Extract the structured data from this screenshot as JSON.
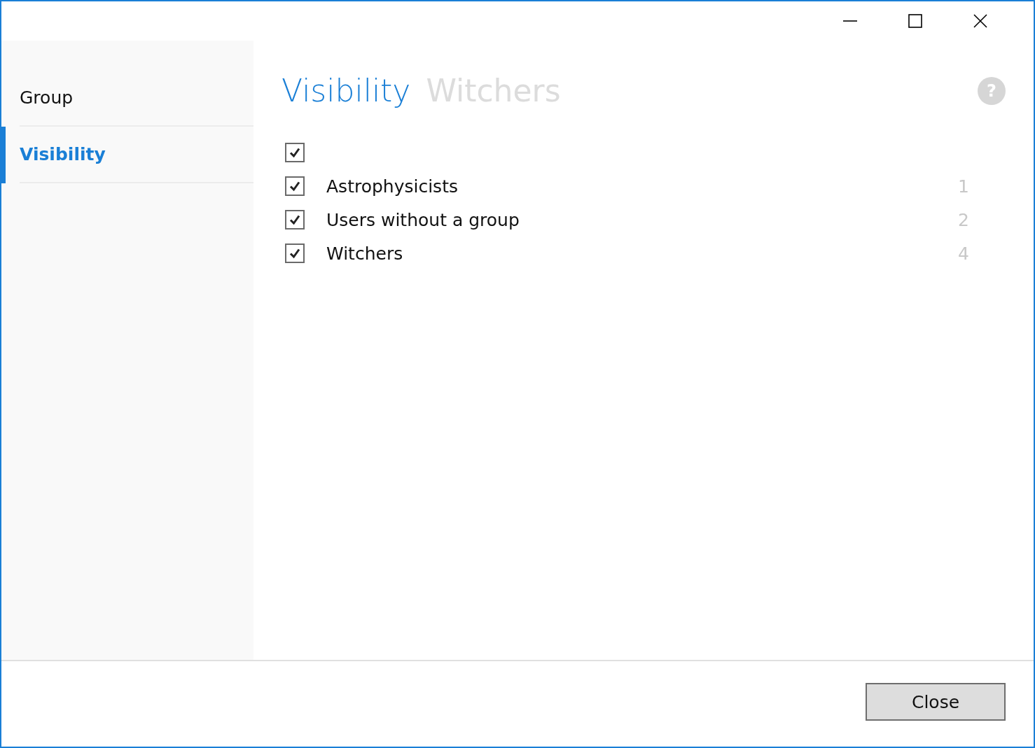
{
  "window": {
    "controls": [
      {
        "kind": "minimize"
      },
      {
        "kind": "maximize"
      },
      {
        "kind": "close"
      }
    ]
  },
  "sidebar": {
    "items": [
      {
        "label": "Group",
        "selected": false
      },
      {
        "label": "Visibility",
        "selected": true
      }
    ]
  },
  "header": {
    "title": "Visibility",
    "subtitle": "Witchers",
    "help": "?"
  },
  "list": [
    {
      "kind": "select_all",
      "checked": true
    },
    {
      "kind": "group",
      "label": "Astrophysicists",
      "count": "1",
      "checked": true
    },
    {
      "kind": "group",
      "label": "Users without a group",
      "count": "2",
      "checked": true
    },
    {
      "kind": "group",
      "label": "Witchers",
      "count": "4",
      "checked": true
    }
  ],
  "buttons": [
    {
      "label": "Close"
    }
  ]
}
